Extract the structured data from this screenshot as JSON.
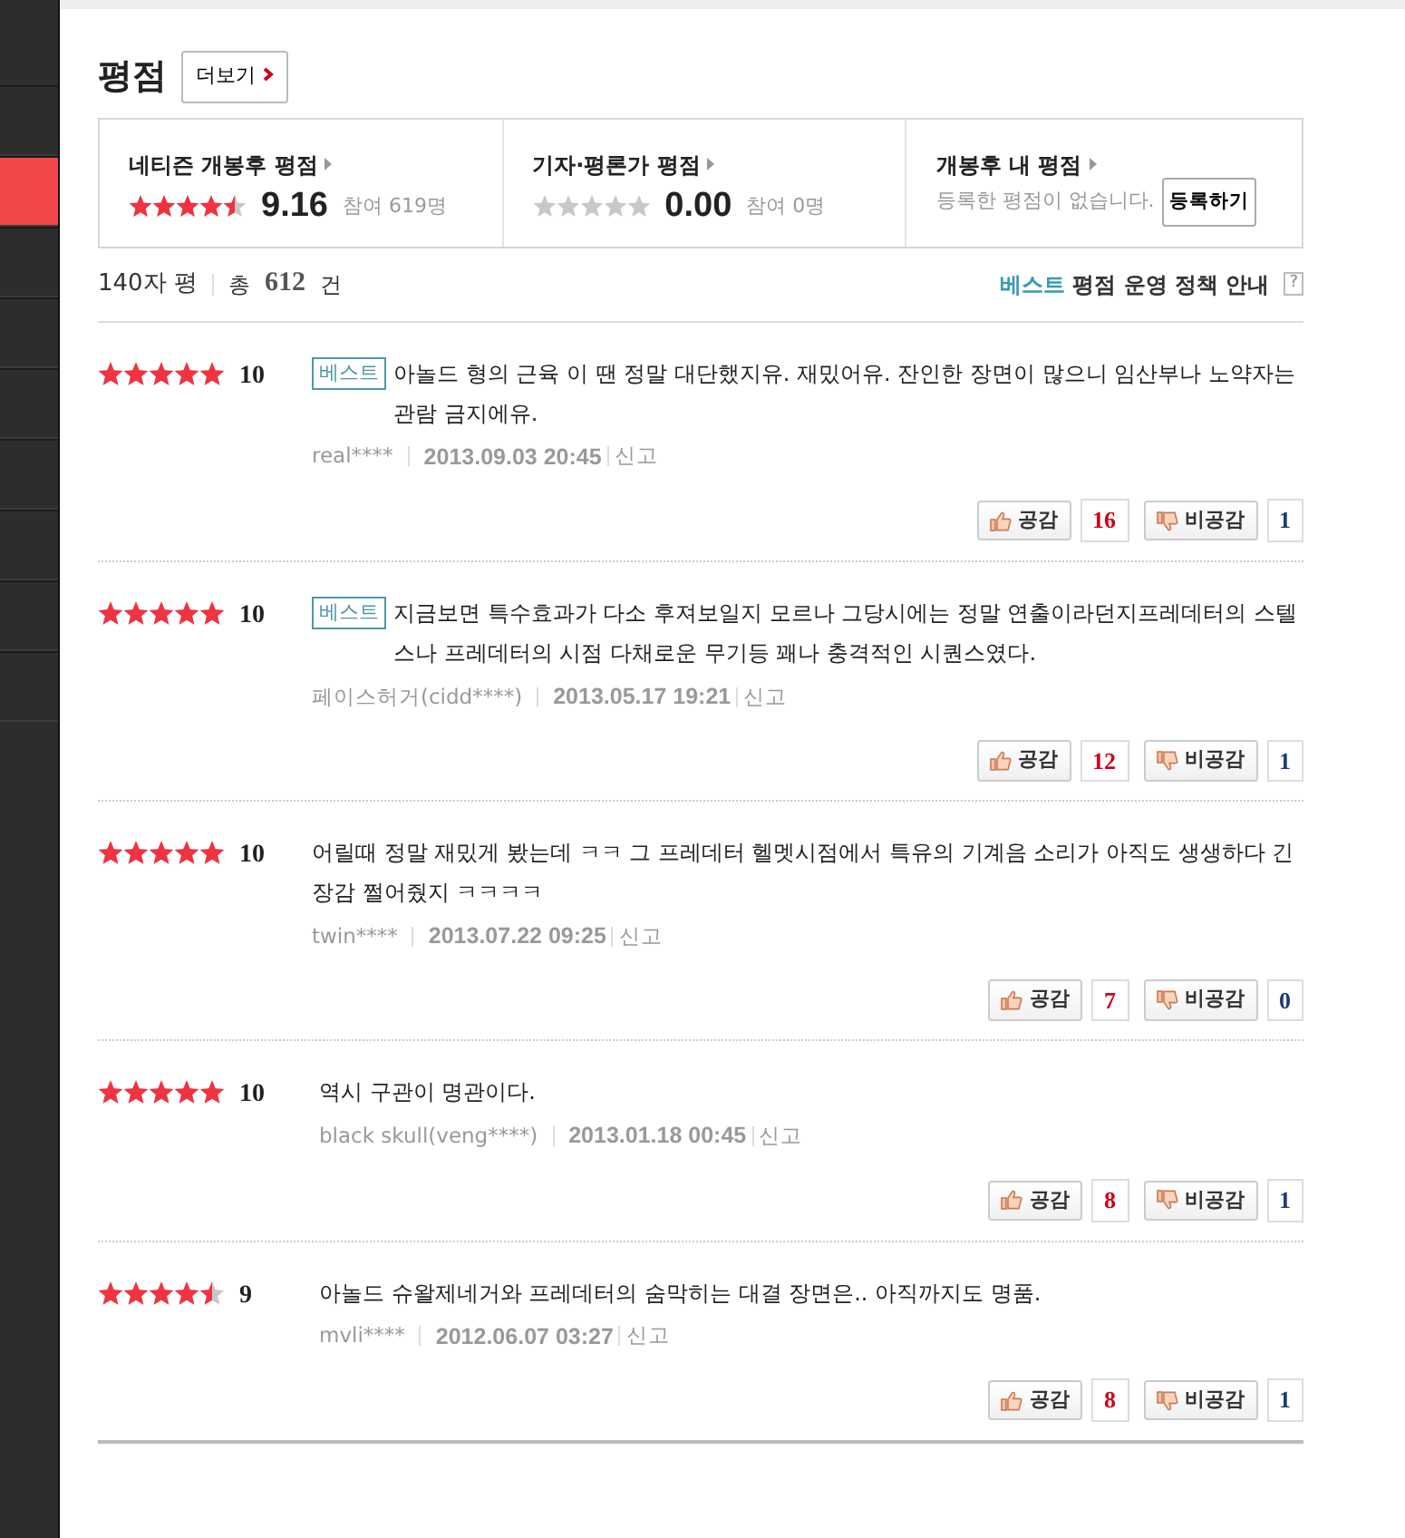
{
  "sidebar": {
    "items": [
      {
        "selected": false
      },
      {
        "selected": true
      },
      {
        "selected": false
      },
      {
        "selected": false
      },
      {
        "selected": false
      },
      {
        "selected": false
      },
      {
        "selected": false
      },
      {
        "selected": false
      },
      {
        "selected": false
      }
    ]
  },
  "section": {
    "title": "평점",
    "more_button": "더보기"
  },
  "summary": [
    {
      "kind": "score",
      "title": "네티즌 개봉후 평점",
      "stars": 4.5,
      "score": "9.16",
      "participants": "참여 619명"
    },
    {
      "kind": "score",
      "title": "기자·평론가 평점",
      "stars": 0,
      "score": "0.00",
      "participants": "참여 0명"
    },
    {
      "kind": "mine",
      "title": "개봉후 내 평점",
      "message": "등록한 평점이 없습니다.",
      "button": "등록하기"
    }
  ],
  "list_header": {
    "title": "140자 평",
    "total_label": "총",
    "total": "612",
    "unit": "건",
    "policy_best": "베스트",
    "policy_text": "평점 운영 정책 안내",
    "help": "?"
  },
  "reviews": [
    {
      "stars": 5,
      "score": "10",
      "best": true,
      "best_label": "베스트",
      "text": "아놀드 형의 근육 이 땐 정말 대단했지유. 재밌어유. 잔인한 장면이 많으니 임산부나 노약자는 관람 금지에유.",
      "author": "real****",
      "date": "2013.09.03 20:45",
      "report": "신고",
      "like": "공감",
      "likes": "16",
      "dislike": "비공감",
      "dislikes": "1"
    },
    {
      "stars": 5,
      "score": "10",
      "best": true,
      "best_label": "베스트",
      "text": "지금보면 특수효과가 다소 후져보일지 모르나 그당시에는 정말 연출이라던지프레데터의 스텔스나 프레데터의 시점 다채로운 무기등 꽤나 충격적인 시퀀스였다.",
      "author": "페이스허거(cidd****)",
      "date": "2013.05.17 19:21",
      "report": "신고",
      "like": "공감",
      "likes": "12",
      "dislike": "비공감",
      "dislikes": "1"
    },
    {
      "stars": 5,
      "score": "10",
      "best": false,
      "text": "어릴때 정말 재밌게 봤는데 ㅋㅋ 그 프레데터 헬멧시점에서 특유의 기계음 소리가 아직도 생생하다 긴장감 쩔어줬지 ㅋㅋㅋㅋ",
      "author": "twin****",
      "date": "2013.07.22 09:25",
      "report": "신고",
      "like": "공감",
      "likes": "7",
      "dislike": "비공감",
      "dislikes": "0"
    },
    {
      "stars": 5,
      "score": "10",
      "best": false,
      "text": "역시 구관이 명관이다.",
      "author": "black skull(veng****)",
      "date": "2013.01.18 00:45",
      "report": "신고",
      "like": "공감",
      "likes": "8",
      "dislike": "비공감",
      "dislikes": "1"
    },
    {
      "stars": 4.5,
      "score": "9",
      "best": false,
      "text": "아놀드 슈왈제네거와 프레데터의 숨막히는 대결 장면은.. 아직까지도 명품.",
      "author": "mvli****",
      "date": "2012.06.07 03:27",
      "report": "신고",
      "like": "공감",
      "likes": "8",
      "dislike": "비공감",
      "dislikes": "1"
    }
  ]
}
